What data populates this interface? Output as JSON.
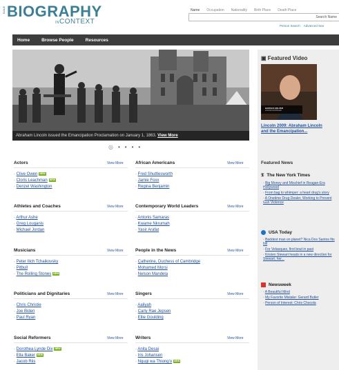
{
  "header": {
    "logo_gale": "GALE",
    "logo_main": "BIOGRAPHY",
    "logo_in": "IN",
    "logo_sub": "CONTEXT",
    "search_tabs": [
      "Name",
      "Occupation",
      "Nationality",
      "Birth Place",
      "Death Place"
    ],
    "search_placeholder": "Search Name",
    "links": [
      "Person Search",
      "Advanced Sea"
    ]
  },
  "nav": {
    "items": [
      "Home",
      "Browse People",
      "Resources"
    ]
  },
  "hero": {
    "caption": "Abraham Lincoln issued the Emancipation Proclamation on January 1, 1863.",
    "view_more": "View More",
    "slide_count": 5,
    "active_slide": 1
  },
  "categories": [
    {
      "title": "Actors",
      "more": "View More",
      "items": [
        {
          "name": "Clive Owen",
          "new": true
        },
        {
          "name": "Cloris Leachman",
          "new": true
        },
        {
          "name": "Denzel Washington",
          "new": false
        }
      ]
    },
    {
      "title": "African Americans",
      "more": "View More",
      "items": [
        {
          "name": "Fred Shuttlesworth",
          "new": false
        },
        {
          "name": "Jamie Foxx",
          "new": false
        },
        {
          "name": "Regina Benjamin",
          "new": false
        }
      ]
    },
    {
      "title": "Athletes and Coaches",
      "more": "View More",
      "items": [
        {
          "name": "Arthur Ashe",
          "new": false
        },
        {
          "name": "Greg Louganis",
          "new": false
        },
        {
          "name": "Michael Jordan",
          "new": false
        }
      ]
    },
    {
      "title": "Contemporary World Leaders",
      "more": "View More",
      "items": [
        {
          "name": "Antonis Samaras",
          "new": false
        },
        {
          "name": "Kwame Nkrumah",
          "new": false
        },
        {
          "name": "Yasir Arafat",
          "new": false
        }
      ]
    },
    {
      "title": "Musicians",
      "more": "View More",
      "items": [
        {
          "name": "Peter Ilich Tchaikovsky",
          "new": false
        },
        {
          "name": "Pitbull",
          "new": false
        },
        {
          "name": "The Rolling Stones",
          "new": true
        }
      ]
    },
    {
      "title": "People in the News",
      "more": "View More",
      "items": [
        {
          "name": "Catherine, Duchess of Cambridge",
          "new": false
        },
        {
          "name": "Mohamed Morsi",
          "new": false
        },
        {
          "name": "Nelson Mandela",
          "new": false
        }
      ]
    },
    {
      "title": "Politicians and Dignitaries",
      "more": "View More",
      "items": [
        {
          "name": "Chris Christie",
          "new": false
        },
        {
          "name": "Joe Biden",
          "new": false
        },
        {
          "name": "Paul Ryan",
          "new": false
        }
      ]
    },
    {
      "title": "Singers",
      "more": "View More",
      "items": [
        {
          "name": "Aaliyah",
          "new": false
        },
        {
          "name": "Carly Rae Jepsen",
          "new": false
        },
        {
          "name": "Ellie Goulding",
          "new": false
        }
      ]
    },
    {
      "title": "Social Reformers",
      "more": "View More",
      "items": [
        {
          "name": "Dorothea Lynde Dix",
          "new": true
        },
        {
          "name": "Ella Baker",
          "new": true
        },
        {
          "name": "Jacob Riis",
          "new": false
        }
      ]
    },
    {
      "title": "Writers",
      "more": "View More",
      "items": [
        {
          "name": "Anita Desai",
          "new": false
        },
        {
          "name": "Iris Johansen",
          "new": false
        },
        {
          "name": "Ngugi wa Thiong'o",
          "new": true
        }
      ]
    }
  ],
  "badge_label": "NEW",
  "featured_video": {
    "title": "Featured Video",
    "link": "Lincoln 2009: Abraham Lincoln and the Emancipation...",
    "lower_third_name": "HAROLD HOLZER",
    "lower_third_role": "LINCOLN SCHOLAR"
  },
  "featured_news": {
    "title": "Featured News",
    "sources": [
      {
        "name": "The New York Times",
        "icon": "nyt-icon",
        "items": [
          "Big Money and Mischief in Reagan-Era Hollywood",
          "From bag to whimper: a heart drug's story",
          "A Onetime Drug Dealer, Working to Prevent Gun Violence"
        ]
      },
      {
        "name": "USA Today",
        "icon": "usa-today-icon",
        "items": [
          "Baddest man on planet? Nica Dos Santos fits bill",
          "For Velasquez, first bout in past",
          "Kristen Stewart heads in a new direction for Stewart, her..."
        ]
      },
      {
        "name": "Newsweek",
        "icon": "newsweek-icon",
        "items": [
          "A Beautiful Mind",
          "My Favorite Mistake: Gerard Butler",
          "Person of Interest: Chris Chocola"
        ]
      }
    ]
  },
  "colors": {
    "brand": "#3b7f96",
    "nav_bg": "#3d3d3d",
    "link": "#1f4e9b",
    "new_badge": "#7ab21d",
    "usa_today": "#1a73c9",
    "newsweek": "#d9342b"
  }
}
